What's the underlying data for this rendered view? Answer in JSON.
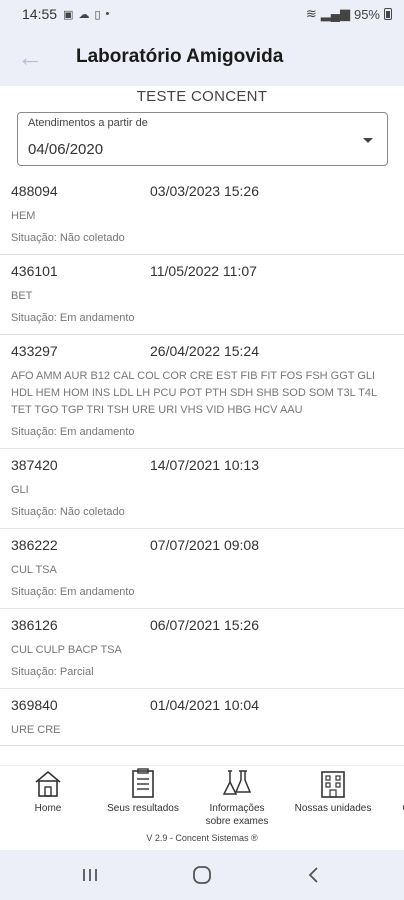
{
  "status_bar": {
    "time": "14:55",
    "battery": "95%"
  },
  "header": {
    "title": "Laboratório Amigovida"
  },
  "patient": {
    "name": "TESTE CONCENT"
  },
  "filter": {
    "label": "Atendimentos a partir de",
    "value": "04/06/2020"
  },
  "records": [
    {
      "code": "488094",
      "datetime": "03/03/2023 15:26",
      "exams": "HEM",
      "status": "Situação: Não coletado"
    },
    {
      "code": "436101",
      "datetime": "11/05/2022 11:07",
      "exams": "BET",
      "status": "Situação: Em andamento"
    },
    {
      "code": "433297",
      "datetime": "26/04/2022 15:24",
      "exams": "AFO AMM AUR B12 CAL COL COR CRE EST FIB FIT FOS FSH GGT GLI HDL HEM HOM INS LDL LH PCU POT PTH SDH SHB SOD SOM T3L T4L TET TGO TGP TRI TSH URE URI VHS VID HBG HCV AAU",
      "status": "Situação: Em andamento"
    },
    {
      "code": "387420",
      "datetime": "14/07/2021 10:13",
      "exams": "GLI",
      "status": "Situação: Não coletado"
    },
    {
      "code": "386222",
      "datetime": "07/07/2021 09:08",
      "exams": "CUL TSA",
      "status": "Situação: Em andamento"
    },
    {
      "code": "386126",
      "datetime": "06/07/2021 15:26",
      "exams": "CUL CULP BACP TSA",
      "status": "Situação: Parcial"
    },
    {
      "code": "369840",
      "datetime": "01/04/2021 10:04",
      "exams": "URE CRE",
      "status": ""
    }
  ],
  "bottom_nav": {
    "home": "Home",
    "results": "Seus resultados",
    "info": "Informações sobre exames",
    "units": "Nossas unidades",
    "more": "C"
  },
  "footer": {
    "version": "V 2.9 - Concent Sistemas ®"
  }
}
